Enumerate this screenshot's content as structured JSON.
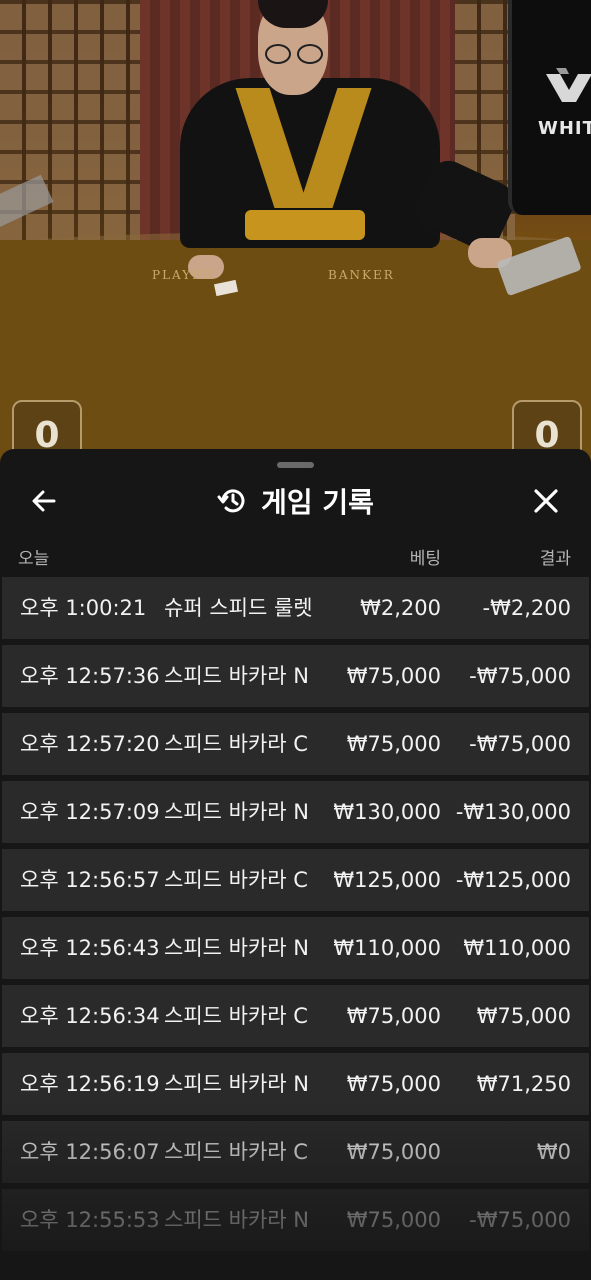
{
  "video": {
    "felt_player": "PLAYER",
    "felt_banker": "BANKER",
    "brand": "WHITE",
    "score_left": "0",
    "score_right": "0"
  },
  "sheet": {
    "title": "게임 기록",
    "back_icon": "arrow-left-icon",
    "history_icon": "history-clock-icon",
    "close_icon": "close-icon",
    "columns": {
      "date": "오늘",
      "bet": "베팅",
      "result": "결과"
    },
    "rows": [
      {
        "time": "오후 1:00:21",
        "game": "슈퍼 스피드 룰렛",
        "bet": "₩2,200",
        "result": "-₩2,200"
      },
      {
        "time": "오후 12:57:36",
        "game": "스피드 바카라 N",
        "bet": "₩75,000",
        "result": "-₩75,000"
      },
      {
        "time": "오후 12:57:20",
        "game": "스피드 바카라 C",
        "bet": "₩75,000",
        "result": "-₩75,000"
      },
      {
        "time": "오후 12:57:09",
        "game": "스피드 바카라 N",
        "bet": "₩130,000",
        "result": "-₩130,000"
      },
      {
        "time": "오후 12:56:57",
        "game": "스피드 바카라 C",
        "bet": "₩125,000",
        "result": "-₩125,000"
      },
      {
        "time": "오후 12:56:43",
        "game": "스피드 바카라 N",
        "bet": "₩110,000",
        "result": "₩110,000"
      },
      {
        "time": "오후 12:56:34",
        "game": "스피드 바카라 C",
        "bet": "₩75,000",
        "result": "₩75,000"
      },
      {
        "time": "오후 12:56:19",
        "game": "스피드 바카라 N",
        "bet": "₩75,000",
        "result": "₩71,250"
      },
      {
        "time": "오후 12:56:07",
        "game": "스피드 바카라 C",
        "bet": "₩75,000",
        "result": "₩0"
      },
      {
        "time": "오후 12:55:53",
        "game": "스피드 바카라 N",
        "bet": "₩75,000",
        "result": "-₩75,000"
      }
    ]
  },
  "colors": {
    "sheet_bg": "#161616",
    "row_bg": "#2a2a2a",
    "text": "#f2f2f2",
    "muted": "#b4b4b4"
  }
}
